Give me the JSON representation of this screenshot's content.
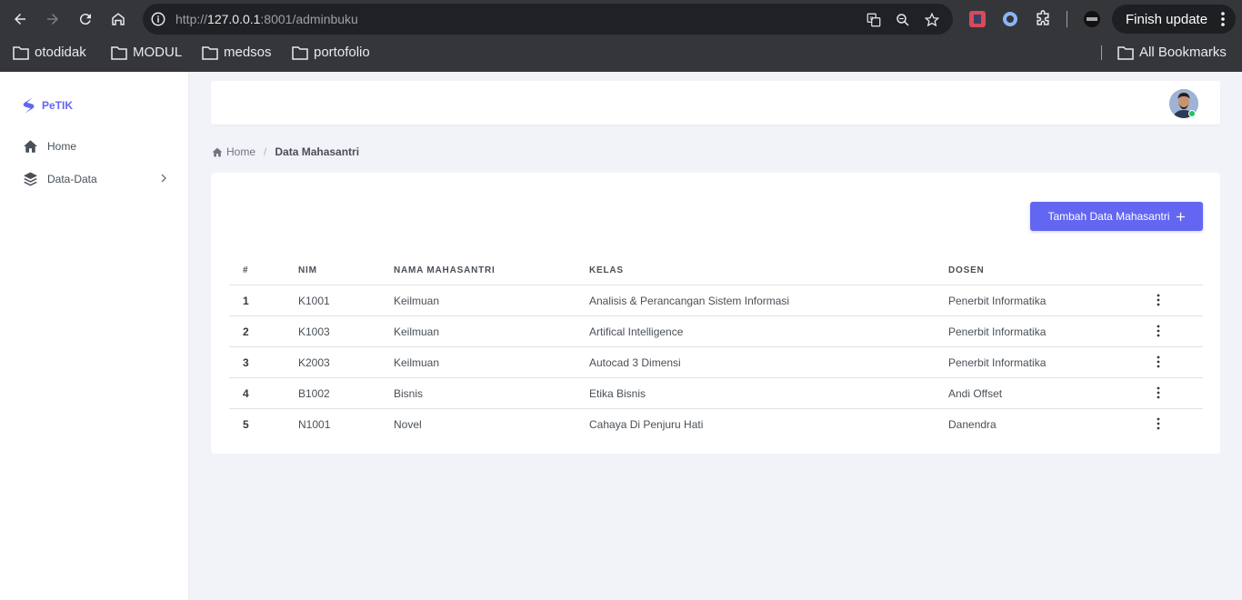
{
  "browser": {
    "url_prefix": "http://",
    "url_host": "127.0.0.1",
    "url_rest": ":8001/adminbuku",
    "finish_update": "Finish update",
    "bookmarks": [
      "otodidak",
      "MODUL",
      "medsos",
      "portofolio"
    ],
    "all_bookmarks": "All Bookmarks"
  },
  "sidebar": {
    "brand": "PeTIK",
    "items": [
      {
        "label": "Home",
        "icon": "home-icon"
      },
      {
        "label": "Data-Data",
        "icon": "layers-icon"
      }
    ]
  },
  "breadcrumb": {
    "home": "Home",
    "sep": "/",
    "current": "Data Mahasantri"
  },
  "main": {
    "add_button": "Tambah Data Mahasantri",
    "headers": [
      "#",
      "NIM",
      "NAMA MAHASANTRI",
      "KELAS",
      "DOSEN"
    ],
    "rows": [
      {
        "no": "1",
        "nim": "K1001",
        "nama": "Keilmuan",
        "kelas": "Analisis & Perancangan Sistem Informasi",
        "dosen": "Penerbit Informatika"
      },
      {
        "no": "2",
        "nim": "K1003",
        "nama": "Keilmuan",
        "kelas": "Artifical Intelligence",
        "dosen": "Penerbit Informatika"
      },
      {
        "no": "3",
        "nim": "K2003",
        "nama": "Keilmuan",
        "kelas": "Autocad 3 Dimensi",
        "dosen": "Penerbit Informatika"
      },
      {
        "no": "4",
        "nim": "B1002",
        "nama": "Bisnis",
        "kelas": "Etika Bisnis",
        "dosen": "Andi Offset"
      },
      {
        "no": "5",
        "nim": "N1001",
        "nama": "Novel",
        "kelas": "Cahaya Di Penjuru Hati",
        "dosen": "Danendra"
      }
    ]
  },
  "colors": {
    "accent": "#6366f1",
    "online": "#22c55e",
    "chrome_dark": "#35363a"
  }
}
